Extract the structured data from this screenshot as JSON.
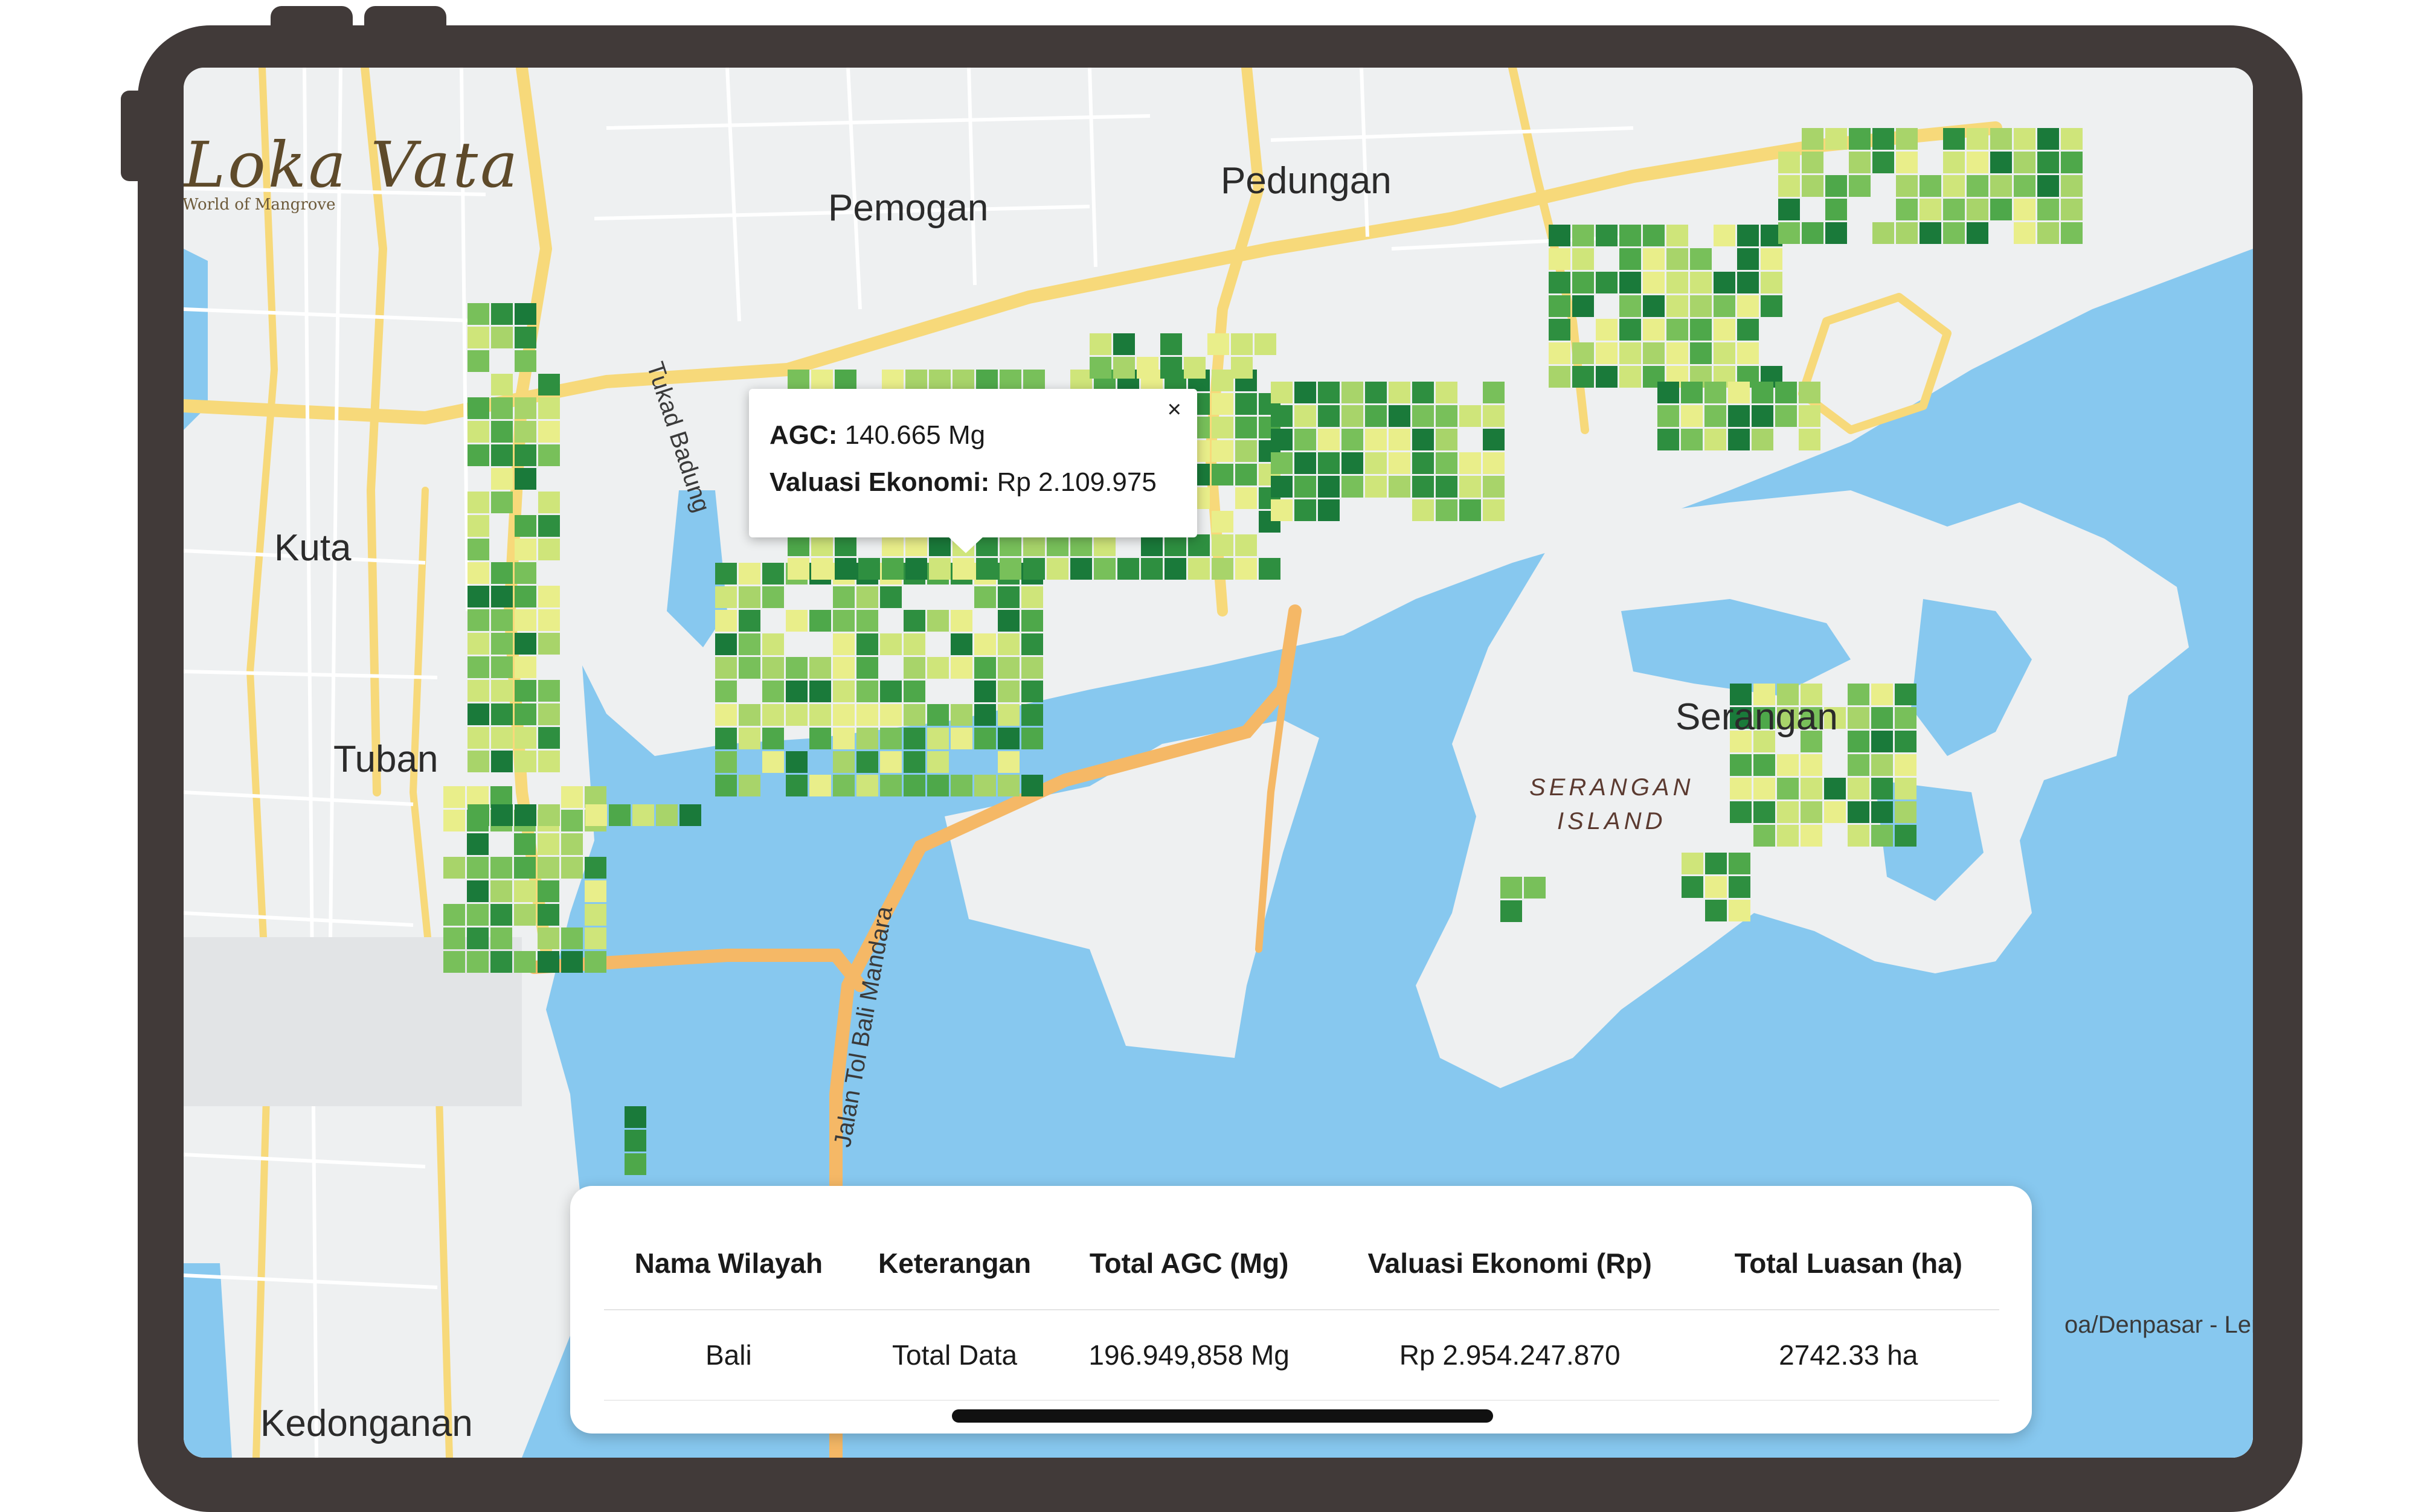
{
  "brand": {
    "name": "Loka Vata",
    "tagline": "World of Mangrove"
  },
  "map": {
    "places": [
      {
        "key": "pemogan",
        "label": "Pemogan"
      },
      {
        "key": "pedungan",
        "label": "Pedungan"
      },
      {
        "key": "kuta",
        "label": "Kuta"
      },
      {
        "key": "tuban",
        "label": "Tuban"
      },
      {
        "key": "serangan",
        "label": "Serangan"
      },
      {
        "key": "kedonganan",
        "label": "Kedonganan"
      }
    ],
    "island_label": [
      "SERANGAN",
      "ISLAND"
    ],
    "road_labels": {
      "tukad": "Tukad Badung",
      "toll": "Jalan Tol Bali Mandara",
      "edge": "oa/Denpasar - Len"
    },
    "colors": {
      "water": "#87c8ef",
      "land": "#eef0f1",
      "road": "#f7d97a",
      "toll": "#f5b866",
      "grid_dark": "#1a7a3a",
      "grid_light": "#e9ee8a"
    }
  },
  "popup": {
    "agc_label": "AGC:",
    "agc_value": "140.665 Mg",
    "valuation_label": "Valuasi Ekonomi:",
    "valuation_value": "Rp 2.109.975",
    "close_icon": "×"
  },
  "summary_table": {
    "headers": [
      "Nama Wilayah",
      "Keterangan",
      "Total AGC (Mg)",
      "Valuasi Ekonomi (Rp)",
      "Total Luasan (ha)"
    ],
    "rows": [
      [
        "Bali",
        "Total Data",
        "196.949,858 Mg",
        "Rp 2.954.247.870",
        "2742.33 ha"
      ]
    ]
  }
}
